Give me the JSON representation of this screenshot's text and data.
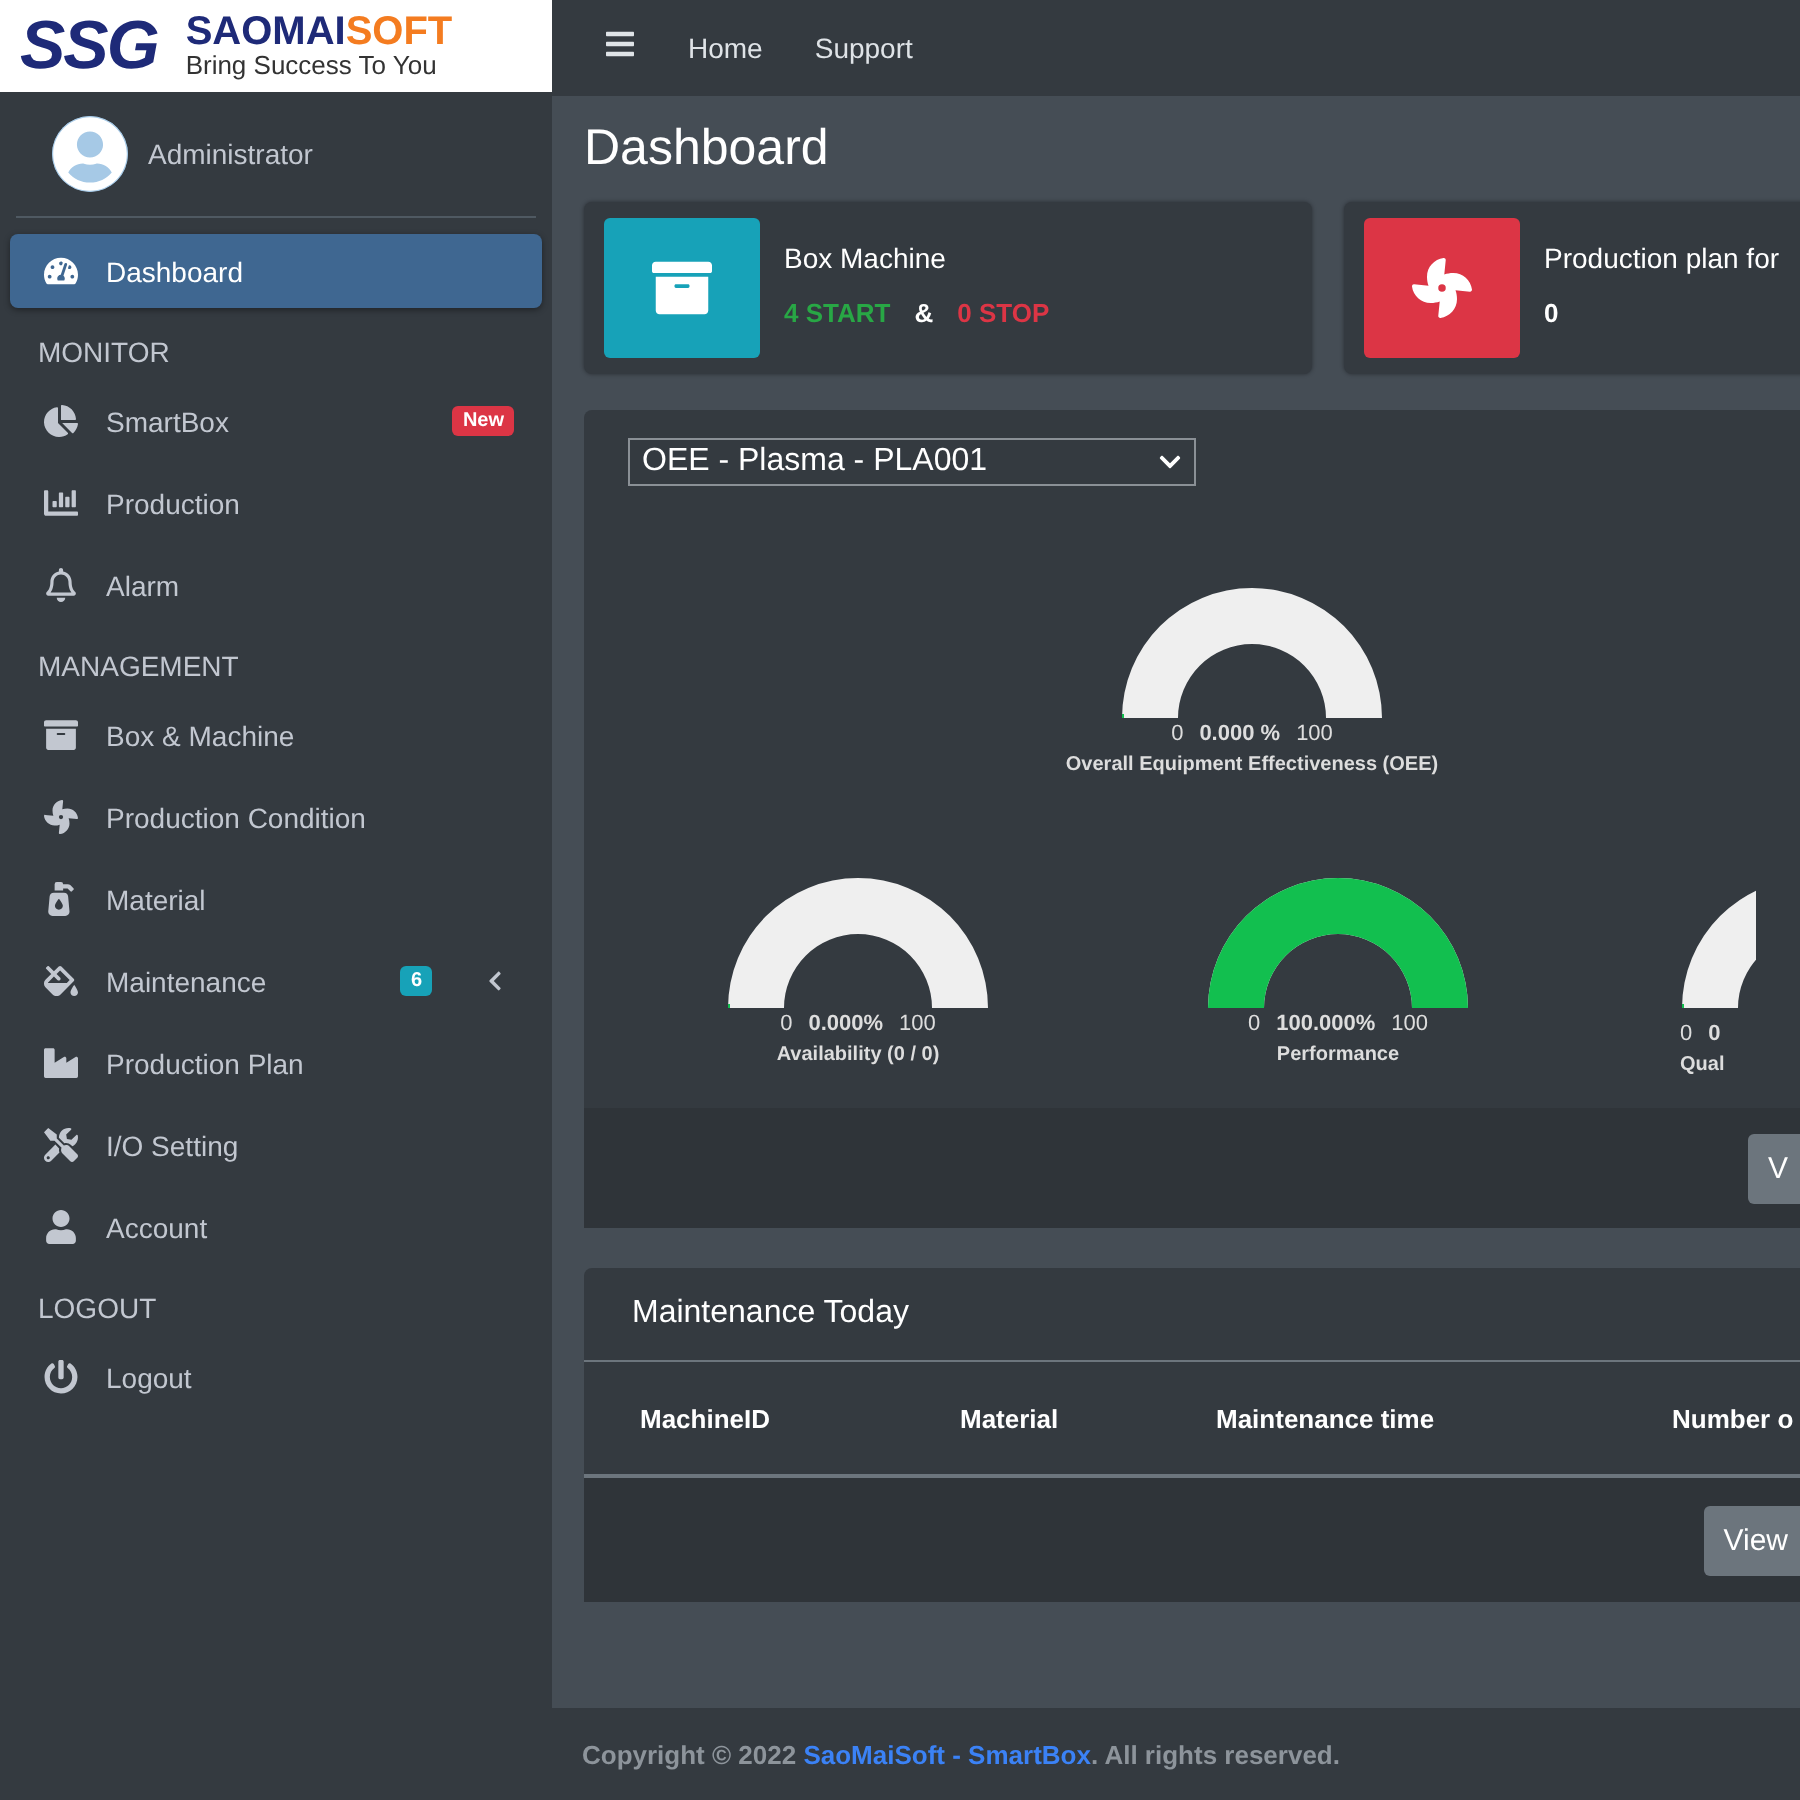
{
  "logo": {
    "mark": "SSG",
    "name_primary": "SAOMAI",
    "name_accent": "SOFT",
    "tagline": "Bring Success To You"
  },
  "topbar": {
    "links": [
      "Home",
      "Support"
    ]
  },
  "user": {
    "name": "Administrator"
  },
  "sidebar": {
    "sections": [
      {
        "items": [
          {
            "label": "Dashboard",
            "selected": true,
            "has_submenu": false
          }
        ]
      },
      {
        "heading": "MONITOR",
        "items": [
          {
            "label": "SmartBox",
            "selected": false,
            "has_submenu": false,
            "badge": {
              "text": "New",
              "color": "#dc3545"
            }
          },
          {
            "label": "Production",
            "selected": false,
            "has_submenu": false
          },
          {
            "label": "Alarm",
            "selected": false,
            "has_submenu": false
          }
        ]
      },
      {
        "heading": "MANAGEMENT",
        "items": [
          {
            "label": "Box & Machine",
            "selected": false,
            "has_submenu": false
          },
          {
            "label": "Production Condition",
            "selected": false,
            "has_submenu": false
          },
          {
            "label": "Material",
            "selected": false,
            "has_submenu": false
          },
          {
            "label": "Maintenance",
            "selected": false,
            "has_submenu": true,
            "badge": {
              "text": "6",
              "color": "#17a2b8"
            }
          },
          {
            "label": "Production Plan",
            "selected": false,
            "has_submenu": false
          },
          {
            "label": "I/O Setting",
            "selected": false,
            "has_submenu": false
          },
          {
            "label": "Account",
            "selected": false,
            "has_submenu": false
          }
        ]
      },
      {
        "heading": "LOGOUT",
        "items": [
          {
            "label": "Logout",
            "selected": false,
            "has_submenu": false
          }
        ]
      }
    ]
  },
  "page_title": "Dashboard",
  "info_boxes": [
    {
      "title": "Box Machine",
      "color": "#17a2b8",
      "values": [
        {
          "text": "4 START",
          "color": "#28a745"
        },
        {
          "text": "&",
          "color": "#ffffff"
        },
        {
          "text": "0 STOP",
          "color": "#dc3545"
        }
      ]
    },
    {
      "title": "Production plan for",
      "color": "#dc3545",
      "values": [
        {
          "text": "0",
          "color": "#ffffff"
        }
      ]
    }
  ],
  "oee_card": {
    "select": "OEE - Plasma - PLA001",
    "main_gauge": {
      "min": "0",
      "value": "0.000 %",
      "max": "100",
      "label": "Overall Equipment Effectiveness (OEE)",
      "level": 0
    },
    "gauges": [
      {
        "min": "0",
        "value": "0.000%",
        "max": "100",
        "label": "Availability (0 / 0)",
        "level": 0
      },
      {
        "min": "0",
        "value": "100.000%",
        "max": "100",
        "label": "Performance",
        "level": 1
      },
      {
        "min": "0",
        "value": "0",
        "label": "Qual",
        "level": 0
      }
    ],
    "button": "V"
  },
  "maintenance": {
    "title": "Maintenance Today",
    "columns": [
      "MachineID",
      "Material",
      "Maintenance time",
      "Number o"
    ],
    "button": "View"
  },
  "footer": {
    "prefix": "Copyright © 2022 ",
    "link": "SaoMaiSoft - SmartBox",
    "suffix": ". All rights reserved."
  }
}
